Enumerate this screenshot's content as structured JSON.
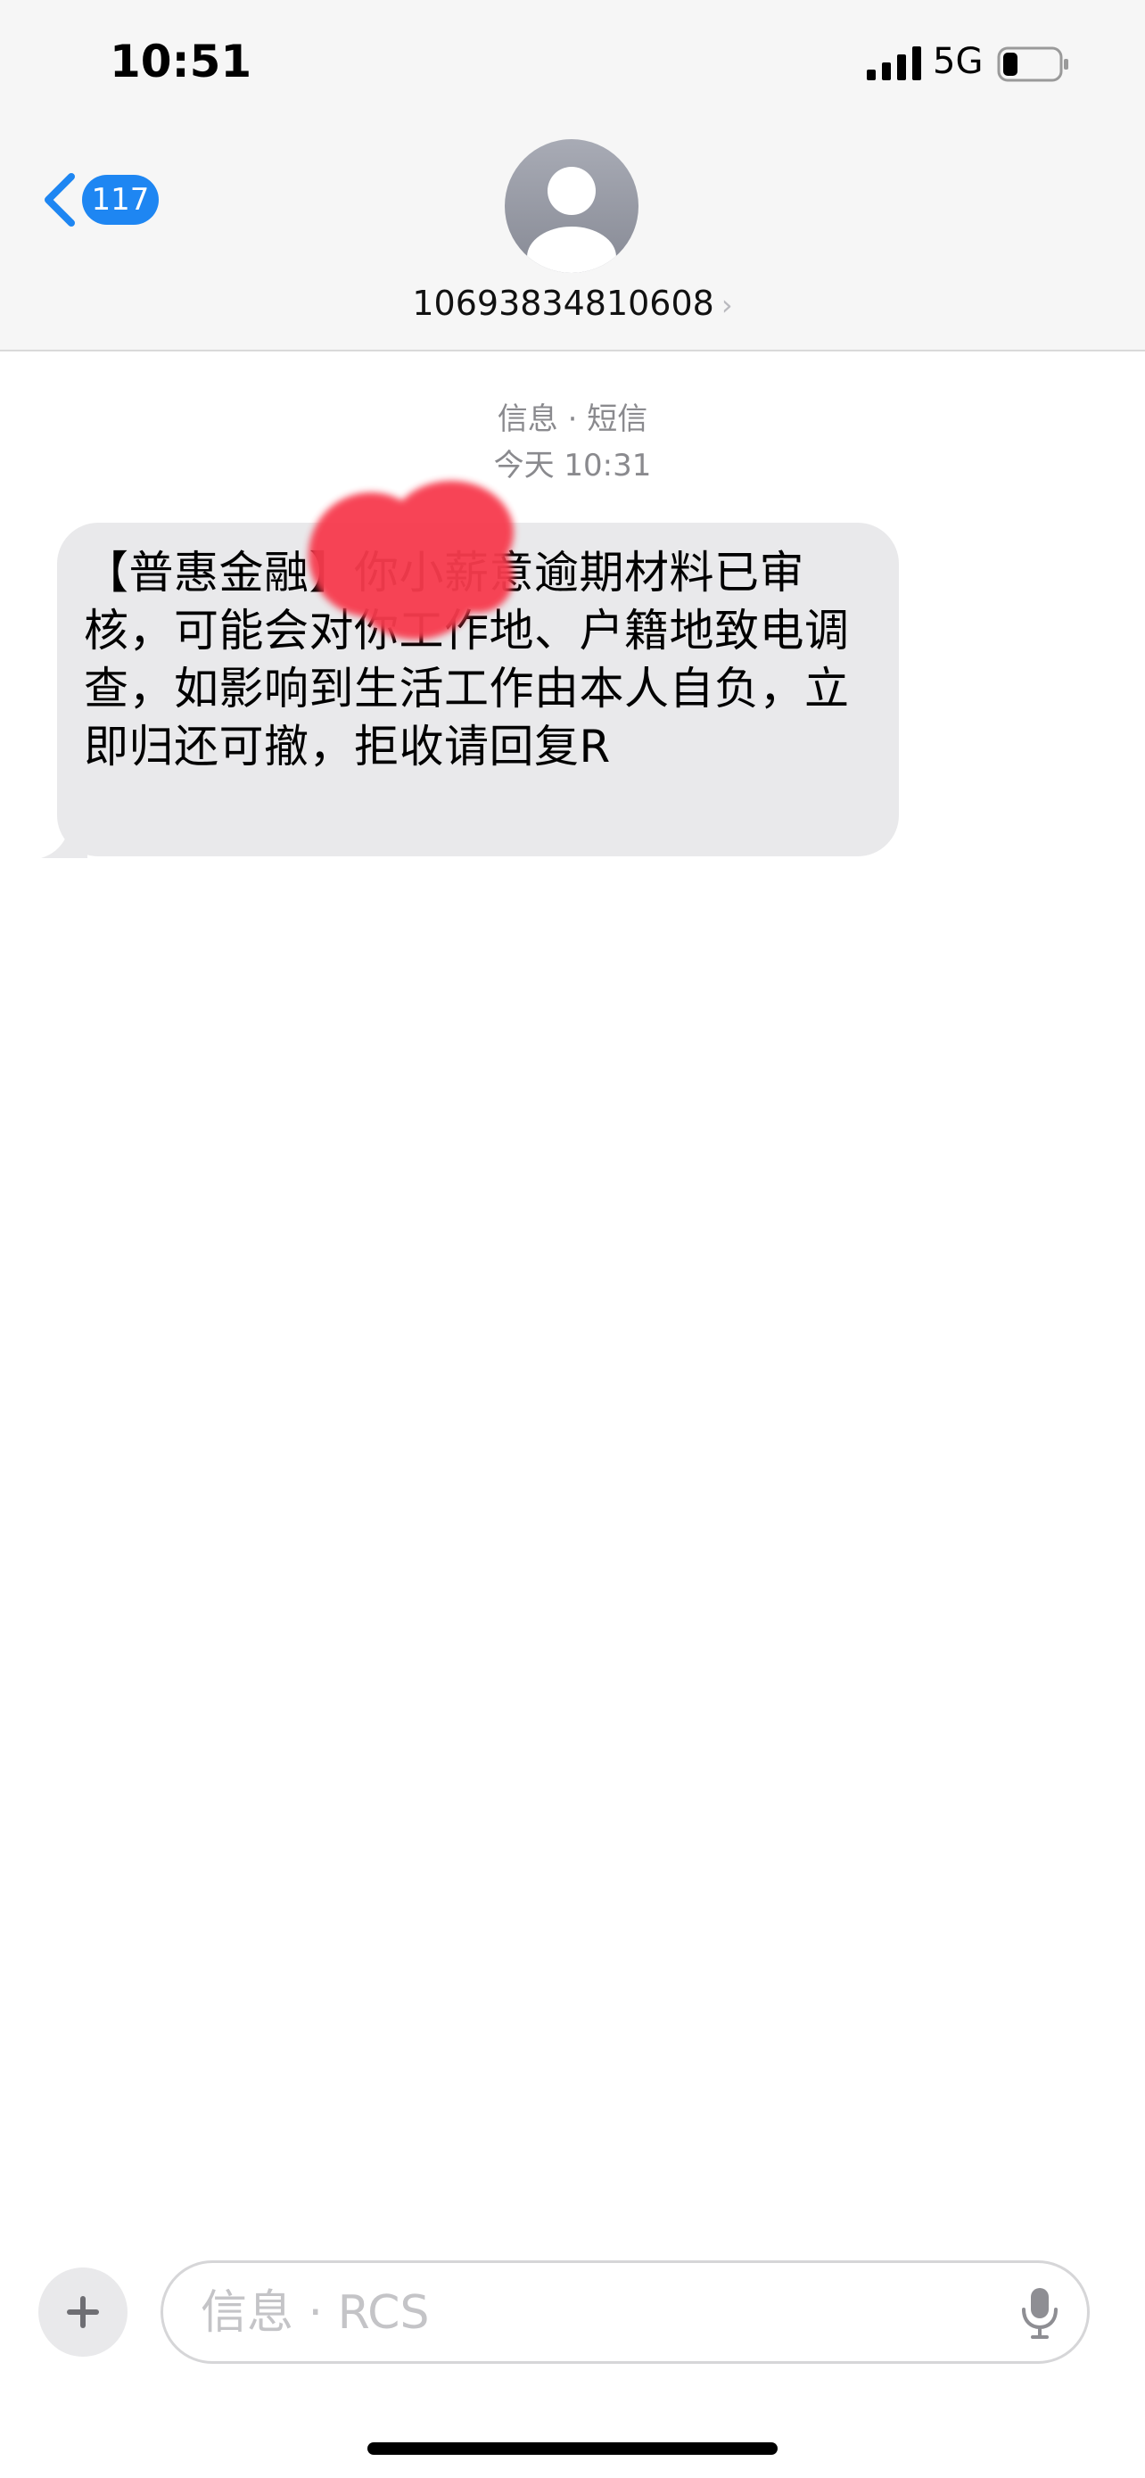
{
  "status_bar": {
    "time": "10:51",
    "network": "5G",
    "signal_icon": "cellular-signal-icon",
    "battery_icon": "battery-low-icon"
  },
  "header": {
    "back_count": "117",
    "contact_number": "10693834810608",
    "chevron": "›",
    "back_icon": "chevron-left-icon",
    "avatar_icon": "person-silhouette-icon",
    "accent_color": "#1e86f2"
  },
  "thread": {
    "channel_label": "信息 · 短信",
    "timestamp": "今天 10:31",
    "messages": [
      {
        "direction": "incoming",
        "text": "【普惠金融】你小薪意逾期材料已审核，可能会对你工作地、户籍地致电调查，如影响到生活工作由本人自负，立即归还可撤，拒收请回复R",
        "partially_redacted": true
      }
    ]
  },
  "composer": {
    "placeholder": "信息 · RCS",
    "value": "",
    "plus_icon": "plus-icon",
    "mic_icon": "microphone-icon"
  }
}
